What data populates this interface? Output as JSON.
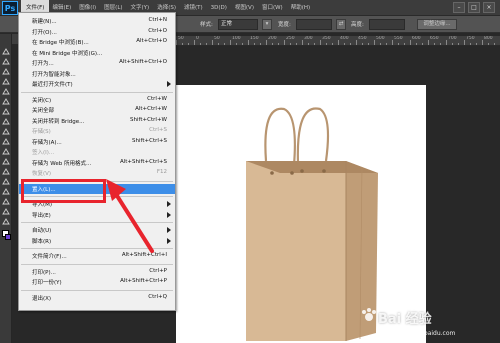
{
  "app": {
    "logo": "Ps"
  },
  "menubar": {
    "items": [
      "文件(F)",
      "编辑(E)",
      "图像(I)",
      "图层(L)",
      "文字(Y)",
      "选择(S)",
      "滤镜(T)",
      "3D(D)",
      "视图(V)",
      "窗口(W)",
      "帮助(H)"
    ],
    "active_index": 0
  },
  "options": {
    "style_label": "样式:",
    "style_value": "正常",
    "width_label": "宽度:",
    "height_label": "高度:",
    "refine_button": "调整边缘..."
  },
  "ruler": {
    "numbers": [
      "50",
      "0",
      "50",
      "100",
      "150",
      "200",
      "250",
      "300",
      "350",
      "400",
      "450",
      "500",
      "550",
      "600",
      "650",
      "700",
      "750",
      "800"
    ]
  },
  "file_menu": {
    "items": [
      {
        "label": "新建(N)...",
        "shortcut": "Ctrl+N"
      },
      {
        "label": "打开(O)...",
        "shortcut": "Ctrl+O"
      },
      {
        "label": "在 Bridge 中浏览(B)...",
        "shortcut": "Alt+Ctrl+O"
      },
      {
        "label": "在 Mini Bridge 中浏览(G)...",
        "shortcut": ""
      },
      {
        "label": "打开为...",
        "shortcut": "Alt+Shift+Ctrl+O"
      },
      {
        "label": "打开为智能对象...",
        "shortcut": ""
      },
      {
        "label": "最近打开文件(T)",
        "shortcut": "",
        "submenu": true
      },
      {
        "separator": true
      },
      {
        "label": "关闭(C)",
        "shortcut": "Ctrl+W"
      },
      {
        "label": "关闭全部",
        "shortcut": "Alt+Ctrl+W"
      },
      {
        "label": "关闭并转到 Bridge...",
        "shortcut": "Shift+Ctrl+W"
      },
      {
        "label": "存储(S)",
        "shortcut": "Ctrl+S",
        "disabled": true
      },
      {
        "label": "存储为(A)...",
        "shortcut": "Shift+Ctrl+S"
      },
      {
        "label": "签入(I)...",
        "shortcut": "",
        "disabled": true
      },
      {
        "label": "存储为 Web 所用格式...",
        "shortcut": "Alt+Shift+Ctrl+S"
      },
      {
        "label": "恢复(V)",
        "shortcut": "F12",
        "disabled": true
      },
      {
        "separator": true
      },
      {
        "label": "置入(L)...",
        "shortcut": "",
        "highlight": true
      },
      {
        "separator": true
      },
      {
        "label": "导入(M)",
        "shortcut": "",
        "submenu": true
      },
      {
        "label": "导出(E)",
        "shortcut": "",
        "submenu": true
      },
      {
        "separator": true
      },
      {
        "label": "自动(U)",
        "shortcut": "",
        "submenu": true
      },
      {
        "label": "脚本(R)",
        "shortcut": "",
        "submenu": true
      },
      {
        "separator": true
      },
      {
        "label": "文件简介(F)...",
        "shortcut": "Alt+Shift+Ctrl+I"
      },
      {
        "separator": true
      },
      {
        "label": "打印(P)...",
        "shortcut": "Ctrl+P"
      },
      {
        "label": "打印一份(Y)",
        "shortcut": "Alt+Shift+Ctrl+P"
      },
      {
        "separator": true
      },
      {
        "label": "退出(X)",
        "shortcut": "Ctrl+Q"
      }
    ]
  },
  "watermark": {
    "main": "Bai 经验",
    "sub": "jingyan.baidu.com"
  },
  "colors": {
    "accent": "#3d8ee8",
    "annotation": "#e8242d",
    "bag": "#d2b48c"
  }
}
